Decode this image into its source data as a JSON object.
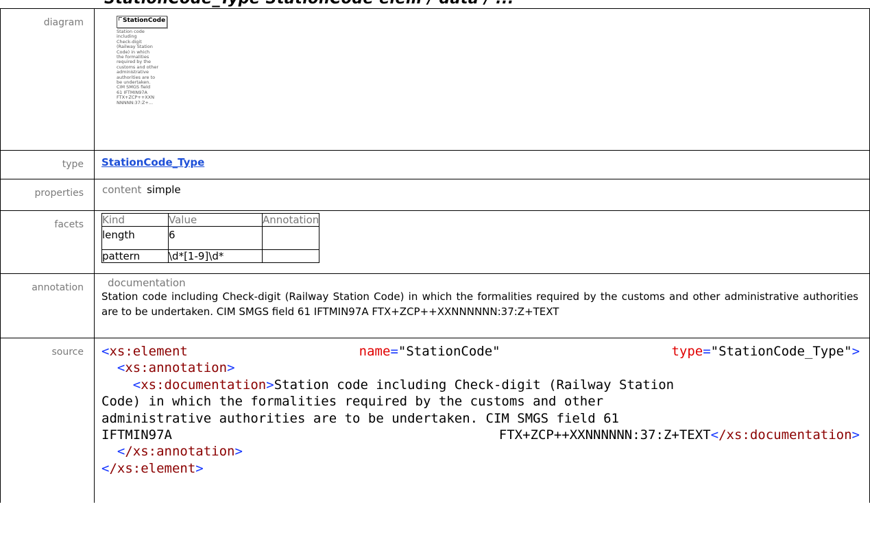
{
  "top_clip_text": "StationCode_Type  StationCode  elem  /  data  /  ...",
  "diagram": {
    "label": "diagram",
    "element_name": "StationCode",
    "doc_lines": [
      "Station code",
      "including",
      "Check-digit",
      "(Railway Station",
      "Code) in which",
      "the formalities",
      "required by the",
      "customs and other",
      "administrative",
      "authorities are to",
      "be undertaken.",
      "CIM SMGS field",
      "61 IFTMIN97A",
      "FTX+ZCP++XXN",
      "NNNNN:37:Z+..."
    ]
  },
  "type": {
    "label": "type",
    "value": "StationCode_Type"
  },
  "properties": {
    "label": "properties",
    "key": "content",
    "value": "simple"
  },
  "facets": {
    "label": "facets",
    "headers": [
      "Kind",
      "Value",
      "Annotation"
    ],
    "rows": [
      {
        "kind": "length",
        "value": "6"
      },
      {
        "kind": "pattern",
        "value": "\\d*[1-9]\\d*"
      }
    ]
  },
  "annotation": {
    "label": "annotation",
    "heading": "documentation",
    "text": "Station code including Check-digit (Railway Station Code) in which the formalities required by the customs and other administrative authorities are to be undertaken. CIM SMGS field 61 IFTMIN97A FTX+ZCP++XXNNNNNN:37:Z+TEXT"
  },
  "source": {
    "label": "source",
    "open_tag": "xs:element",
    "attr_name": "name",
    "attr_name_val": "\"StationCode\"",
    "attr_type": "type",
    "attr_type_val": "\"StationCode_Type\"",
    "annotation_tag": "xs:annotation",
    "documentation_tag": "xs:documentation",
    "doc_line1": "Station code including Check-digit (Railway Station",
    "doc_line2": "Code) in which the formalities required by the customs and other",
    "doc_line3": "administrative authorities are to be undertaken. CIM SMGS field 61",
    "doc_line4a": "IFTMIN97A",
    "doc_line4b": "FTX+ZCP++XXNNNNNN:37:Z+TEXT",
    "close_documentation": "/xs:documentation",
    "close_annotation": "/xs:annotation",
    "close_element": "/xs:element"
  }
}
